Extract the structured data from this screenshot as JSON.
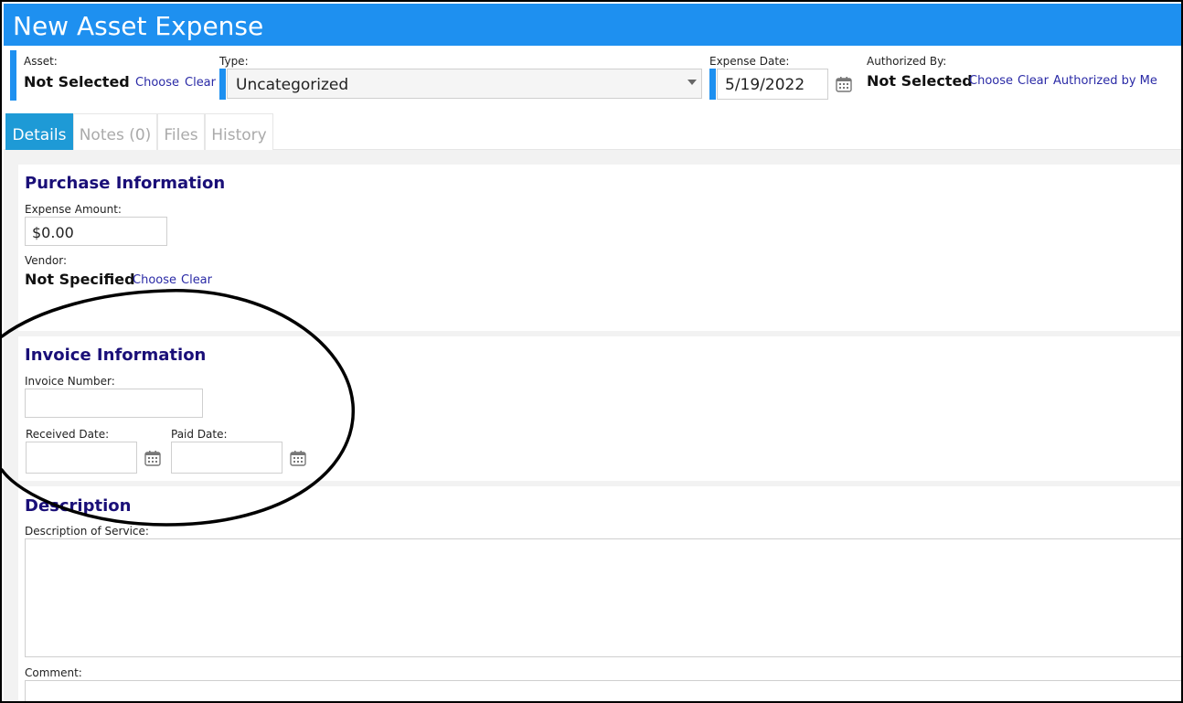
{
  "window": {
    "title": "New Asset Expense"
  },
  "header": {
    "asset": {
      "label": "Asset:",
      "value": "Not Selected",
      "choose": "Choose",
      "clear": "Clear"
    },
    "type": {
      "label": "Type:",
      "value": "Uncategorized"
    },
    "expense_date": {
      "label": "Expense Date:",
      "value": "5/19/2022"
    },
    "authorized_by": {
      "label": "Authorized By:",
      "value": "Not Selected",
      "choose": "Choose",
      "clear": "Clear",
      "authorized_by_me": "Authorized by Me"
    }
  },
  "tabs": [
    {
      "label": "Details",
      "active": true
    },
    {
      "label": "Notes (0)",
      "active": false
    },
    {
      "label": "Files",
      "active": false
    },
    {
      "label": "History",
      "active": false
    }
  ],
  "purchase": {
    "title": "Purchase Information",
    "expense_amount_label": "Expense Amount:",
    "expense_amount_value": "$0.00",
    "vendor_label": "Vendor:",
    "vendor_value": "Not Specified",
    "choose": "Choose",
    "clear": "Clear"
  },
  "invoice": {
    "title": "Invoice Information",
    "invoice_number_label": "Invoice Number:",
    "invoice_number_value": "",
    "received_date_label": "Received Date:",
    "received_date_value": "",
    "paid_date_label": "Paid Date:",
    "paid_date_value": ""
  },
  "description": {
    "title": "Description",
    "description_label": "Description of Service:",
    "description_value": "",
    "comment_label": "Comment:",
    "comment_value": ""
  },
  "colors": {
    "accent": "#1e90f0",
    "active_tab": "#1e9ad6",
    "section_title": "#1a0f78",
    "link": "#2a2aa6"
  },
  "icons": {
    "calendar": "calendar-icon",
    "dropdown": "chevron-down-icon"
  }
}
